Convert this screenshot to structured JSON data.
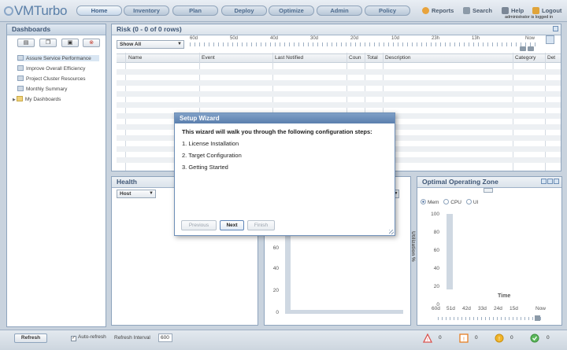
{
  "app": {
    "logo_text": "VMTurbo",
    "logged_in_text": "administrator is logged in"
  },
  "nav": {
    "tabs": [
      "Home",
      "Inventory",
      "Plan",
      "Deploy",
      "Optimize",
      "Admin",
      "Policy"
    ],
    "active": "Home"
  },
  "toplinks": {
    "reports": "Reports",
    "search": "Search",
    "help": "Help",
    "logout": "Logout"
  },
  "dashboards": {
    "title": "Dashboards",
    "items": [
      "Assure Service Performance",
      "Improve Overall Efficiency",
      "Project Cluster Resources",
      "Monthly Summary",
      "My Dashboards"
    ],
    "selected": "Assure Service Performance"
  },
  "risk": {
    "title": "Risk (0 - 0 of 0 rows)",
    "filter": "Show All",
    "timeline": [
      "60d",
      "50d",
      "40d",
      "30d",
      "20d",
      "10d",
      "23h",
      "13h",
      "Now"
    ],
    "columns": [
      "Name",
      "Event",
      "Last Notified",
      "Coun",
      "Total",
      "Description",
      "Category",
      "Det"
    ]
  },
  "health": {
    "title": "Health",
    "filter": "Host"
  },
  "middle_chart": {
    "yticks": [
      "60",
      "40",
      "20",
      "0"
    ]
  },
  "ooz": {
    "title": "Optimal Operating Zone",
    "radios": [
      "Mem",
      "CPU",
      "UI"
    ],
    "selected_radio": "Mem",
    "ylabel": "Utilization %",
    "yticks": [
      "100",
      "80",
      "60",
      "40",
      "20",
      "0"
    ],
    "xlabel": "Time",
    "xticks": [
      "60d",
      "51d",
      "42d",
      "33d",
      "24d",
      "15d",
      "Now"
    ]
  },
  "wizard": {
    "title": "Setup Wizard",
    "intro": "This wizard will walk you through the following configuration steps:",
    "steps": [
      "1. License Installation",
      "2. Target Configuration",
      "3. Getting Started"
    ],
    "buttons": {
      "previous": "Previous",
      "next": "Next",
      "finish": "Finish"
    }
  },
  "bottom": {
    "refresh": "Refresh",
    "auto_refresh": "Auto-refresh",
    "interval_label": "Refresh Interval",
    "interval_value": "600",
    "alert_counts": [
      "0",
      "0",
      "0",
      "0"
    ]
  },
  "colors": {
    "accent": "#5b7fae",
    "critical": "#d9534f",
    "major": "#e67e22",
    "minor": "#f0b429",
    "ok": "#5cb85c"
  }
}
